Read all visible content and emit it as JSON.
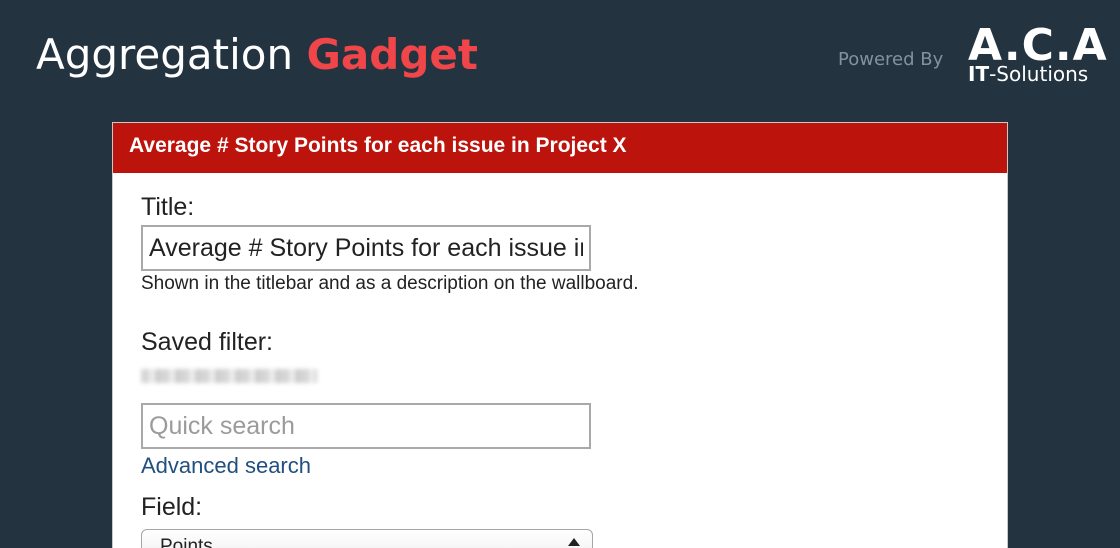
{
  "header": {
    "title_main": "Aggregation",
    "title_accent": "Gadget",
    "powered_by": "Powered By",
    "logo_top": "A.C.A",
    "logo_bold": "IT",
    "logo_rest": "-Solutions"
  },
  "panel": {
    "title": "Average # Story Points for each issue in Project X",
    "title_field": {
      "label": "Title:",
      "value": "Average # Story Points for each issue in Project X",
      "help": "Shown in the titlebar and as a description on the wallboard."
    },
    "saved_filter": {
      "label": "Saved filter:",
      "search_placeholder": "Quick search",
      "advanced_link": "Advanced search"
    },
    "field": {
      "label": "Field:",
      "selected": "Points"
    }
  },
  "colors": {
    "background": "#233340",
    "accent": "#f0464a",
    "panel_header": "#bc130d",
    "link": "#214f7f"
  }
}
